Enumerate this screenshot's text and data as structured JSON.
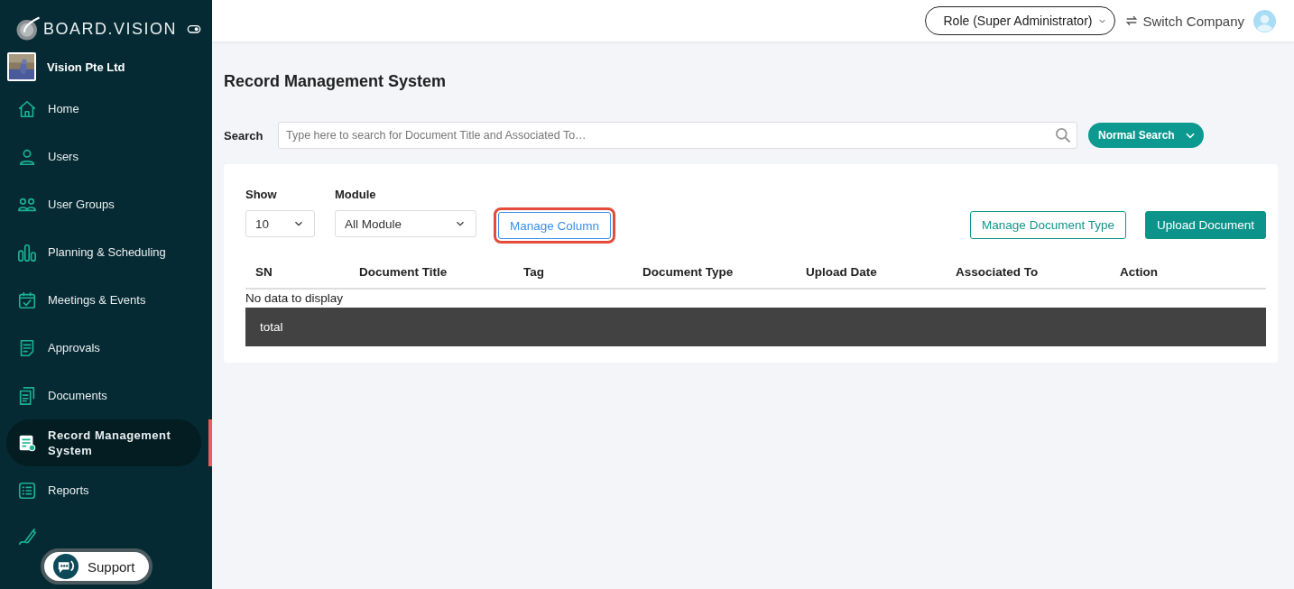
{
  "sidebar": {
    "brand": "BOARD.VISION",
    "company": "Vision Pte Ltd",
    "items": [
      {
        "label": "Home",
        "selected": false
      },
      {
        "label": "Users",
        "selected": false
      },
      {
        "label": "User Groups",
        "selected": false
      },
      {
        "label": "Planning & Scheduling",
        "selected": false
      },
      {
        "label": "Meetings & Events",
        "selected": false
      },
      {
        "label": "Approvals",
        "selected": false
      },
      {
        "label": "Documents",
        "selected": false
      },
      {
        "label": "Record Management System",
        "selected": true
      },
      {
        "label": "Reports",
        "selected": false
      },
      {
        "selected": false
      }
    ],
    "support": "Support"
  },
  "header": {
    "role": "Role (Super Administrator)",
    "switch": "Switch Company"
  },
  "page": {
    "title": "Record Management System",
    "search": {
      "label": "Search",
      "placeholder": "Type here to search for Document Title and Associated To…",
      "mode": "Normal Search"
    },
    "filters": [
      {
        "label": "Show",
        "value": "10"
      },
      {
        "label": "Module",
        "value": "All Module"
      }
    ],
    "buttons": [
      {
        "kind": "outline-blue",
        "label": "Manage Column",
        "highlighted": true
      },
      {
        "kind": "outline-teal",
        "label": "Manage Document Type",
        "highlighted": false
      },
      {
        "kind": "solid",
        "label": "Upload Document",
        "highlighted": false
      }
    ],
    "table": {
      "columns": [
        "SN",
        "Document Title",
        "Tag",
        "Document Type",
        "Upload Date",
        "Associated To",
        "Action"
      ],
      "empty": "No data to display",
      "footer": "total"
    }
  }
}
